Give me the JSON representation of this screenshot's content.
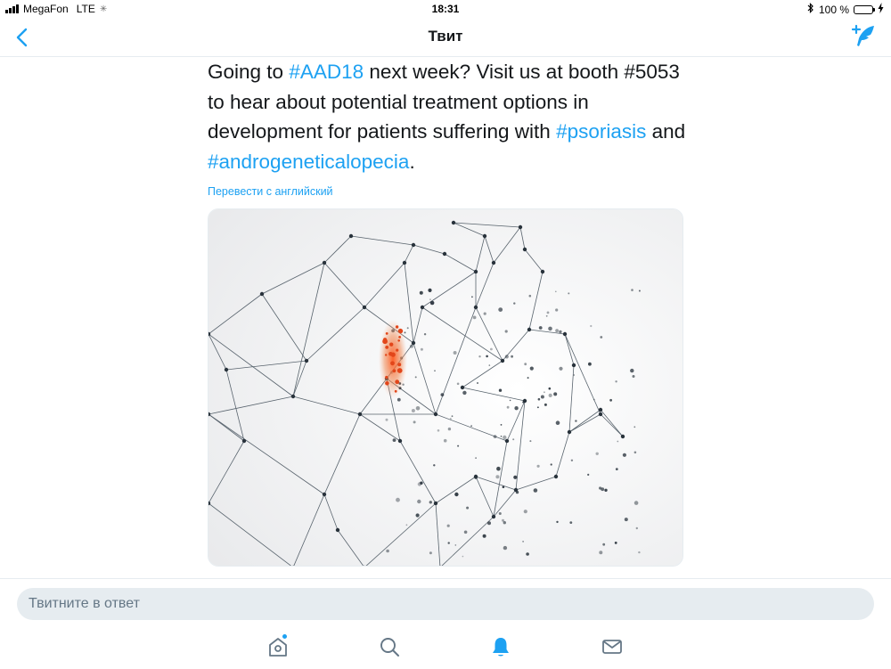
{
  "status_bar": {
    "carrier": "MegaFon",
    "network": "LTE",
    "time": "18:31",
    "battery": "100 %"
  },
  "nav": {
    "title": "Твит",
    "back_icon": "chevron-left-icon",
    "compose_icon": "compose-tweet-icon"
  },
  "tweet": {
    "text_parts": {
      "p1": "Going to ",
      "hashtag1": "#AAD18",
      "p2": " next week? Visit us at booth #5053 to hear about potential treatment options in development for patients suffering with ",
      "hashtag2": "#psoriasis",
      "p3": " and ",
      "hashtag3": "#androgeneticalopecia",
      "p4": "."
    },
    "translate_label": "Перевести с английский"
  },
  "reply": {
    "placeholder": "Твитните в ответ"
  },
  "tab_bar": {
    "items": [
      {
        "name": "home",
        "icon": "home-icon",
        "active": false,
        "has_dot": true
      },
      {
        "name": "search",
        "icon": "search-icon",
        "active": false
      },
      {
        "name": "notifications",
        "icon": "bell-icon",
        "active": true
      },
      {
        "name": "messages",
        "icon": "mail-icon",
        "active": false
      }
    ]
  },
  "colors": {
    "accent": "#1da1f2",
    "text": "#14171a",
    "secondary_text": "#657786",
    "input_bg": "#e6ecf0",
    "battery_green": "#4cd964",
    "highlight_orange": "#e8541c"
  }
}
